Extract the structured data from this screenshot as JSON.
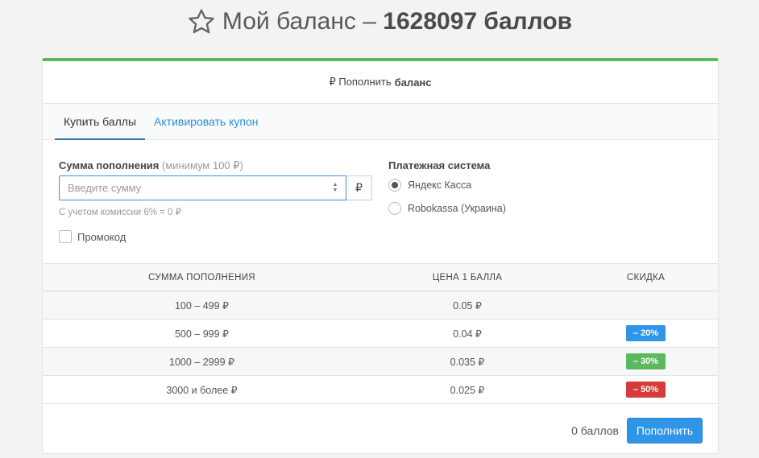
{
  "title": {
    "prefix": "Мой баланс – ",
    "value": "1628097 баллов",
    "icon": "star-outline-icon"
  },
  "card": {
    "header_prefix": "₽ Пополнить",
    "header_bold": "баланс",
    "accent_color": "#5cb85c"
  },
  "tabs": [
    {
      "label": "Купить баллы",
      "active": true
    },
    {
      "label": "Активировать купон",
      "active": false
    }
  ],
  "form": {
    "amount_label": "Сумма пополнения",
    "amount_hint": "(минимум 100 ₽)",
    "amount_placeholder": "Введите сумму",
    "amount_value": "",
    "currency": "₽",
    "commission_text": "С учетом комиссии 6% = 0 ₽",
    "promo_label": "Промокод",
    "promo_checked": false,
    "payment_label": "Платежная система",
    "payment_options": [
      {
        "label": "Яндекс Касса",
        "checked": true
      },
      {
        "label": "Robokassa (Украина)",
        "checked": false
      }
    ]
  },
  "table": {
    "headers": [
      "СУММА ПОПОЛНЕНИЯ",
      "ЦЕНА 1 БАЛЛА",
      "СКИДКА"
    ],
    "rows": [
      {
        "amount": "100 – 499 ₽",
        "price": "0.05 ₽",
        "discount": "",
        "color": ""
      },
      {
        "amount": "500 – 999 ₽",
        "price": "0.04 ₽",
        "discount": "– 20%",
        "color": "#2f95e7"
      },
      {
        "amount": "1000 – 2999 ₽",
        "price": "0.035 ₽",
        "discount": "– 30%",
        "color": "#5cb85c"
      },
      {
        "amount": "3000 и более ₽",
        "price": "0.025 ₽",
        "discount": "– 50%",
        "color": "#d63a3a"
      }
    ]
  },
  "footer": {
    "points_total": "0 баллов",
    "submit_label": "Пополнить"
  }
}
